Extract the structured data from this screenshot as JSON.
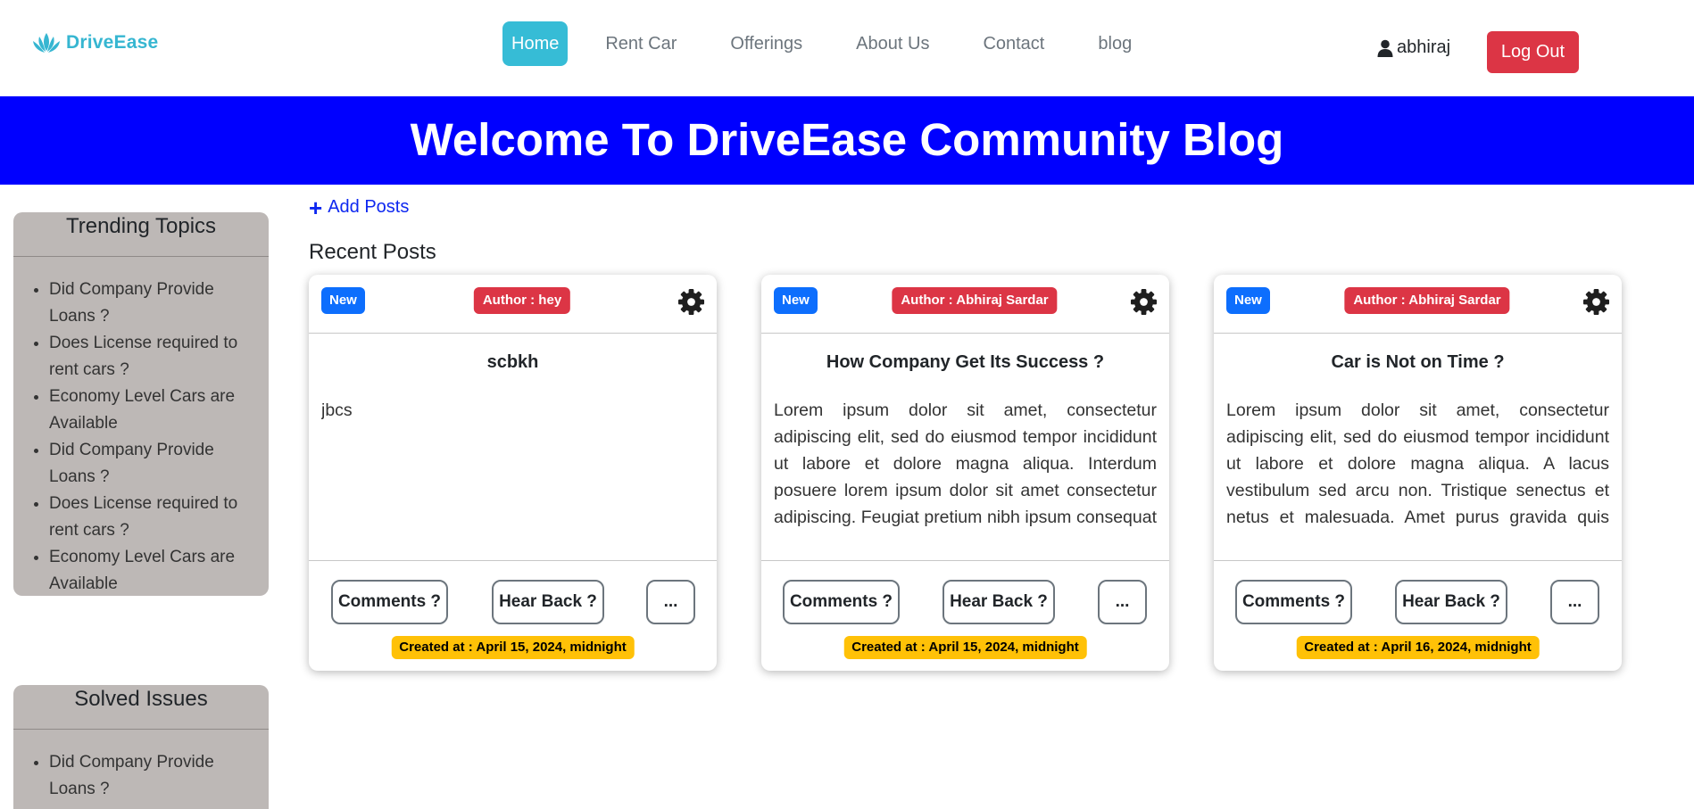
{
  "brand": {
    "name": "DriveEase",
    "color": "#36b6d1"
  },
  "nav": {
    "items": [
      {
        "label": "Home",
        "active": true
      },
      {
        "label": "Rent Car",
        "active": false
      },
      {
        "label": "Offerings",
        "active": false
      },
      {
        "label": "About Us",
        "active": false
      },
      {
        "label": "Contact",
        "active": false
      },
      {
        "label": "blog",
        "active": false
      }
    ],
    "user": "abhiraj",
    "logout_label": "Log Out"
  },
  "banner": {
    "title": "Welcome To DriveEase Community Blog",
    "color": "#0000ff"
  },
  "sidebar": {
    "trending": {
      "title": "Trending Topics",
      "items": [
        "Did Company Provide Loans ?",
        "Does License required to rent cars ?",
        "Economy Level Cars are Available",
        "Did Company Provide Loans ?",
        "Does License required to rent cars ?",
        "Economy Level Cars are Available"
      ]
    },
    "solved": {
      "title": "Solved Issues",
      "items": [
        "Did Company Provide Loans ?"
      ]
    }
  },
  "main": {
    "add_posts_label": "Add Posts",
    "recent_title": "Recent Posts"
  },
  "posts": [
    {
      "badge": "New",
      "author": "Author : hey",
      "title": "scbkh",
      "body": "jbcs",
      "comments_label": "Comments ?",
      "hear_back_label": "Hear Back ?",
      "more_label": "...",
      "created": "Created at : April 15, 2024, midnight"
    },
    {
      "badge": "New",
      "author": "Author : Abhiraj Sardar",
      "title": "How Company Get Its Success ?",
      "body": "Lorem ipsum dolor sit amet, consectetur adipiscing elit, sed do eiusmod tempor incididunt ut labore et dolore magna aliqua. Interdum posuere lorem ipsum dolor sit amet consectetur adipiscing. Feugiat pretium nibh ipsum consequat nisl vel pretium. Vulputate",
      "comments_label": "Comments ?",
      "hear_back_label": "Hear Back ?",
      "more_label": "...",
      "created": "Created at : April 15, 2024, midnight"
    },
    {
      "badge": "New",
      "author": "Author : Abhiraj Sardar",
      "title": "Car is Not on Time ?",
      "body": "Lorem ipsum dolor sit amet, consectetur adipiscing elit, sed do eiusmod tempor incididunt ut labore et dolore magna aliqua. A lacus vestibulum sed arcu non. Tristique senectus et netus et malesuada. Amet purus gravida quis blandit turpis. Curabitur gravida",
      "comments_label": "Comments ?",
      "hear_back_label": "Hear Back ?",
      "more_label": "...",
      "created": "Created at : April 16, 2024, midnight"
    }
  ]
}
